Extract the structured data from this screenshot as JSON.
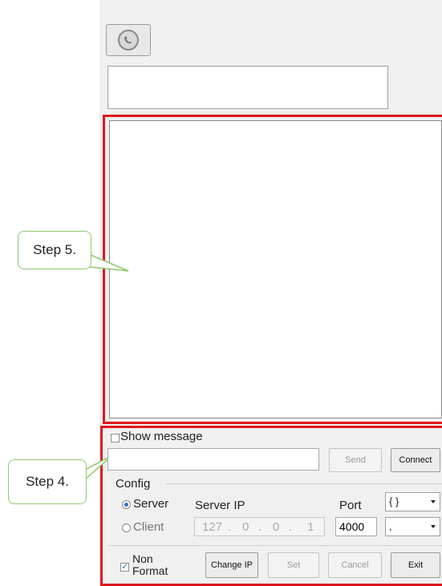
{
  "callouts": {
    "step5": "Step 5.",
    "step4": "Step 4."
  },
  "panel": {
    "show_message_label": "Show message",
    "send_label": "Send",
    "connect_label": "Connect"
  },
  "config": {
    "group_label": "Config",
    "server_label": "Server",
    "client_label": "Client",
    "server_ip_label": "Server IP",
    "ip": [
      "127",
      "0",
      "0",
      "1"
    ],
    "port_label": "Port",
    "port_value": "4000",
    "bracket_combo": "{ }",
    "separator_combo": ","
  },
  "bottom": {
    "non_label": "Non",
    "format_label": "Format",
    "change_ip_label": "Change IP",
    "set_label": "Set",
    "cancel_label": "Cancel",
    "exit_label": "Exit"
  },
  "colors": {
    "highlight": "#e0161d",
    "callout_border": "#8dc86a"
  }
}
